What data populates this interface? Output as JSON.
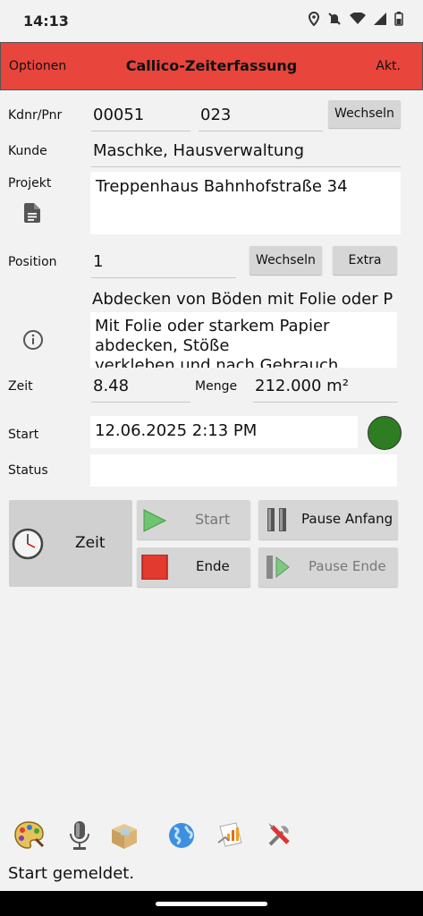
{
  "status_bar": {
    "time": "14:13"
  },
  "app_bar": {
    "options": "Optionen",
    "title": "Callico-Zeiterfassung",
    "action": "Akt."
  },
  "form": {
    "kdnr_label": "Kdnr/Pnr",
    "kdnr_value": "00051",
    "pnr_value": "023",
    "change_button_1": "Wechseln",
    "kunde_label": "Kunde",
    "kunde_value": "Maschke, Hausverwaltung",
    "projekt_label": "Projekt",
    "projekt_value": "Treppenhaus Bahnhofstraße 34",
    "position_label": "Position",
    "position_value": "1",
    "change_button_2": "Wechseln",
    "extra_button": "Extra",
    "position_title": "Abdecken von Böden mit Folie oder P",
    "position_description": "Mit Folie oder starkem Papier abdecken, Stöße\nverkleben und nach Gebrauch",
    "zeit_label": "Zeit",
    "zeit_value": "8.48",
    "menge_label": "Menge",
    "menge_value": "212.000 m²",
    "start_label": "Start",
    "start_value": "12.06.2025 2:13 PM",
    "status_label": "Status",
    "status_value": "",
    "indicator_color": "#2e7d22"
  },
  "actions": {
    "zeit": "Zeit",
    "start": "Start",
    "pause_start": "Pause Anfang",
    "end": "Ende",
    "pause_end": "Pause Ende"
  },
  "toolbar": {
    "icons": [
      "palette-icon",
      "microphone-icon",
      "package-icon",
      "globe-icon",
      "document-chart-icon",
      "tools-icon"
    ]
  },
  "footer": {
    "message": "Start gemeldet."
  }
}
